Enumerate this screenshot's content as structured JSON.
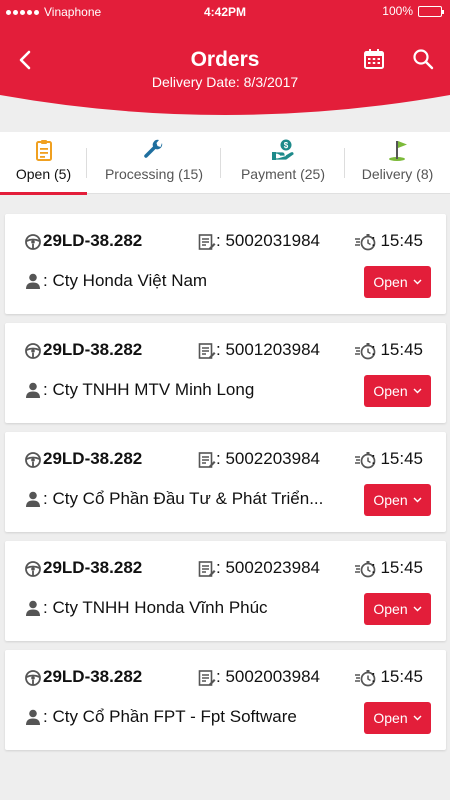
{
  "colors": {
    "brand": "#e31e3a",
    "background": "#eeeeee"
  },
  "status_bar": {
    "carrier": "Vinaphone",
    "time": "4:42PM",
    "battery": "100%",
    "battery_level": 1.0
  },
  "header": {
    "title": "Orders",
    "subtitle": "Delivery Date: 8/3/2017",
    "icons": [
      "back-arrow-icon",
      "calendar-icon",
      "search-icon"
    ]
  },
  "tabs": [
    {
      "label": "Open (5)",
      "icon": "clipboard-icon",
      "active": true
    },
    {
      "label": "Processing (15)",
      "icon": "wrench-icon",
      "active": false
    },
    {
      "label": "Payment (25)",
      "icon": "money-hand-icon",
      "active": false
    },
    {
      "label": "Delivery (8)",
      "icon": "flag-icon",
      "active": false
    }
  ],
  "orders": [
    {
      "plate": "29LD-38.282",
      "order_no": ": 5002031984",
      "time": ": 15:45",
      "customer": ": Cty Honda Việt Nam",
      "status": "Open"
    },
    {
      "plate": "29LD-38.282",
      "order_no": ": 5001203984",
      "time": ": 15:45",
      "customer": ": Cty TNHH MTV Minh Long",
      "status": "Open"
    },
    {
      "plate": "29LD-38.282",
      "order_no": ": 5002203984",
      "time": ": 15:45",
      "customer": ": Cty Cổ Phần Đầu Tư & Phát Triển...",
      "status": "Open"
    },
    {
      "plate": "29LD-38.282",
      "order_no": ": 5002023984",
      "time": ": 15:45",
      "customer": ": Cty TNHH Honda Vĩnh Phúc",
      "status": "Open"
    },
    {
      "plate": "29LD-38.282",
      "order_no": ": 5002003984",
      "time": ": 15:45",
      "customer": ": Cty Cổ Phần FPT - Fpt Software",
      "status": "Open"
    }
  ],
  "row_icons": [
    "steering-wheel-icon",
    "invoice-icon",
    "timer-icon",
    "person-icon",
    "chevron-down-icon"
  ]
}
